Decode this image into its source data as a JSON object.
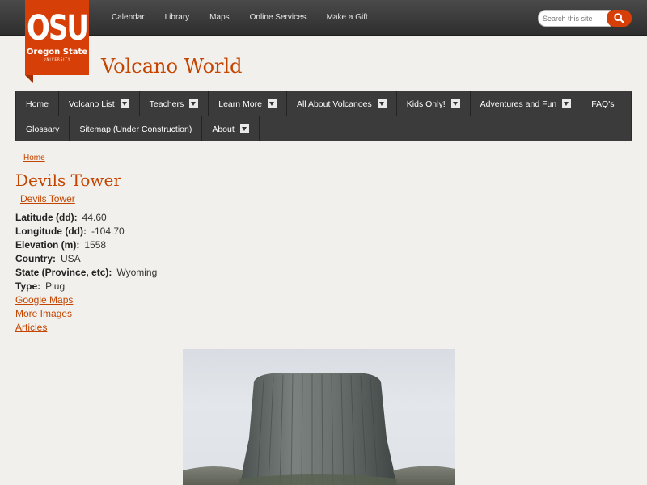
{
  "logo": {
    "big": "OSU",
    "line1": "Oregon State",
    "line2": "UNIVERSITY"
  },
  "toplinks": [
    "Calendar",
    "Library",
    "Maps",
    "Online Services",
    "Make a Gift"
  ],
  "search": {
    "placeholder": "Search this site"
  },
  "site_title": "Volcano World",
  "nav": {
    "row1": [
      {
        "label": "Home",
        "dropdown": false
      },
      {
        "label": "Volcano List",
        "dropdown": true
      },
      {
        "label": "Teachers",
        "dropdown": true
      },
      {
        "label": "Learn More",
        "dropdown": true
      },
      {
        "label": "All About Volcanoes",
        "dropdown": true
      },
      {
        "label": "Kids Only!",
        "dropdown": true
      },
      {
        "label": "Adventures and Fun",
        "dropdown": true
      },
      {
        "label": "FAQ's",
        "dropdown": false
      }
    ],
    "row2": [
      {
        "label": "Glossary",
        "dropdown": false
      },
      {
        "label": "Sitemap (Under Construction)",
        "dropdown": false
      },
      {
        "label": "About",
        "dropdown": true
      }
    ]
  },
  "breadcrumb": "Home",
  "page_title": "Devils Tower",
  "sub_link": "Devils Tower",
  "facts": [
    {
      "label": "Latitude (dd):",
      "value": "44.60"
    },
    {
      "label": "Longitude (dd):",
      "value": "-104.70"
    },
    {
      "label": "Elevation (m):",
      "value": "1558"
    },
    {
      "label": "Country:",
      "value": "USA"
    },
    {
      "label": "State (Province, etc):",
      "value": "Wyoming"
    },
    {
      "label": "Type:",
      "value": "Plug"
    }
  ],
  "links": [
    "Google Maps",
    "More Images",
    "Articles"
  ],
  "colors": {
    "accent": "#d73f09",
    "link": "#c34500",
    "nav_bg": "#3b3b3b",
    "topbar": "#3a3a3a"
  }
}
